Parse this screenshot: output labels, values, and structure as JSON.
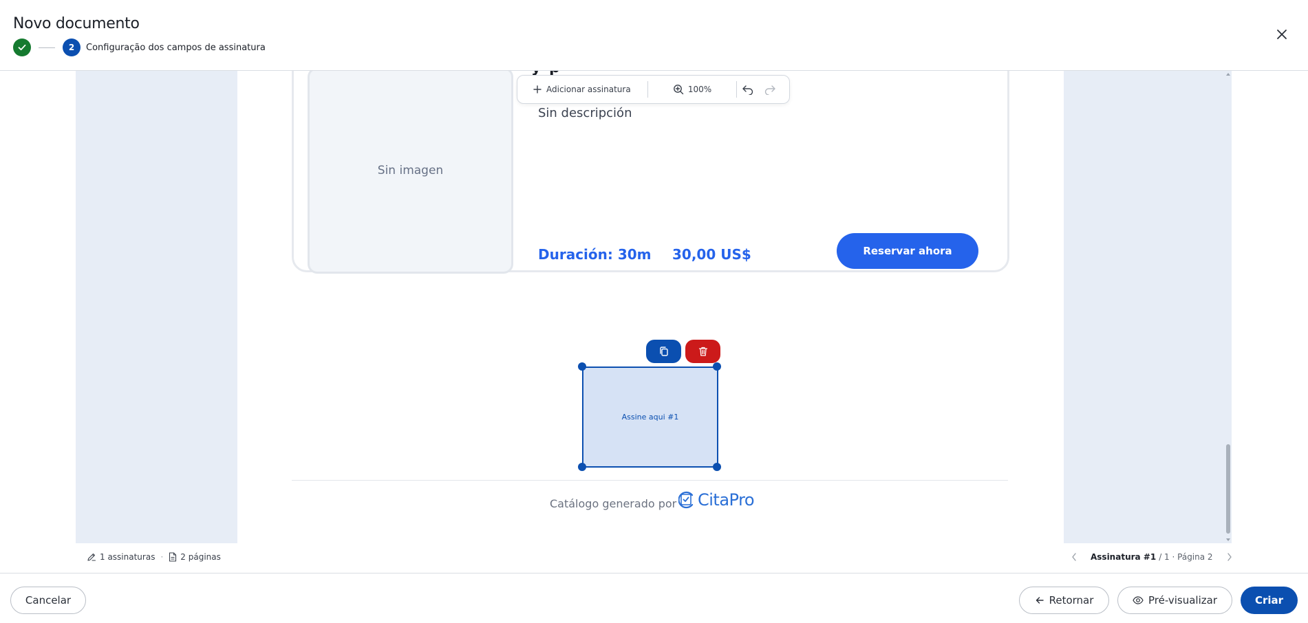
{
  "header": {
    "title": "Novo documento",
    "steps": [
      {
        "label": "",
        "state": "done"
      },
      {
        "number": "2",
        "label": "Configuração dos campos de assinatura",
        "state": "active"
      }
    ]
  },
  "toolbar": {
    "add_signature_label": "Adicionar assinatura",
    "zoom_label": "100%"
  },
  "card": {
    "heading": "y p",
    "no_image_label": "Sin imagen",
    "description": "Sin descripción",
    "duration": "Duración: 30m",
    "price": "30,00 US$",
    "reserve_label": "Reservar ahora"
  },
  "signature_field": {
    "label": "Assine aqui #1"
  },
  "page_footer": {
    "generated_by": "Catálogo generado por",
    "brand": "CitaPro"
  },
  "statusbar": {
    "signatures_count": "1 assinaturas",
    "separator": "·",
    "pages_count": "2 páginas",
    "current_signature": "Assinatura #1",
    "position": "/ 1 · Página 2"
  },
  "footer": {
    "cancel_label": "Cancelar",
    "back_label": "Retornar",
    "preview_label": "Pré-visualizar",
    "create_label": "Criar"
  },
  "colors": {
    "primary": "#0b4fb0",
    "success": "#157a2f",
    "danger": "#cc1a1a",
    "card_accent": "#2563eb",
    "canvas_bg": "#e7edf6"
  },
  "icons": {
    "check": "check-icon",
    "close": "close-icon",
    "plus": "plus-icon",
    "zoom": "zoom-in-icon",
    "undo": "undo-icon",
    "redo": "redo-icon",
    "copy": "copy-icon",
    "trash": "trash-icon",
    "pen": "pen-icon",
    "file": "file-icon",
    "arrow_left": "arrow-left-icon",
    "eye": "eye-icon"
  }
}
